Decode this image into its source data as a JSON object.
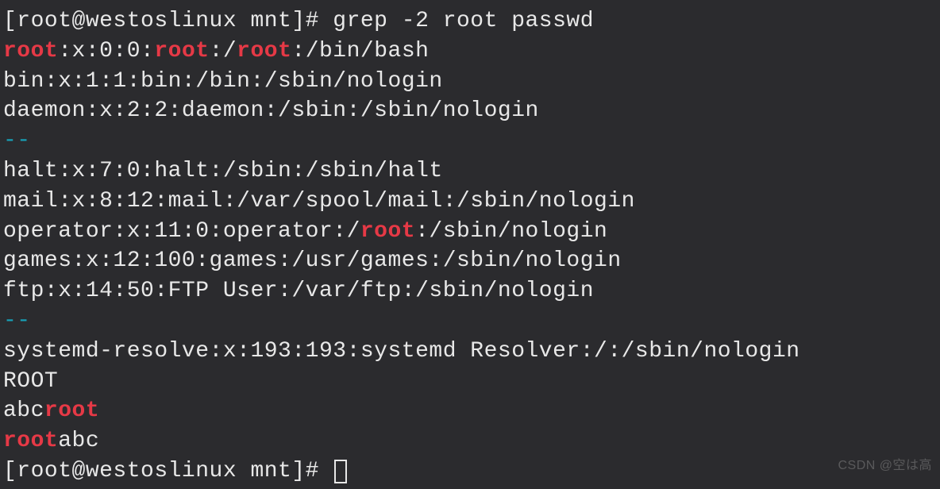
{
  "prompt1_prefix": "[root@westoslinux mnt]# ",
  "command": "grep -2 root passwd",
  "lines": [
    {
      "type": "mixed",
      "parts": [
        {
          "t": "root",
          "h": true
        },
        {
          "t": ":x:0:0:"
        },
        {
          "t": "root",
          "h": true
        },
        {
          "t": ":/"
        },
        {
          "t": "root",
          "h": true
        },
        {
          "t": ":/bin/bash"
        }
      ]
    },
    {
      "type": "plain",
      "text": "bin:x:1:1:bin:/bin:/sbin/nologin"
    },
    {
      "type": "plain",
      "text": "daemon:x:2:2:daemon:/sbin:/sbin/nologin"
    },
    {
      "type": "sep",
      "text": "--"
    },
    {
      "type": "plain",
      "text": "halt:x:7:0:halt:/sbin:/sbin/halt"
    },
    {
      "type": "plain",
      "text": "mail:x:8:12:mail:/var/spool/mail:/sbin/nologin"
    },
    {
      "type": "mixed",
      "parts": [
        {
          "t": "operator:x:11:0:operator:/"
        },
        {
          "t": "root",
          "h": true
        },
        {
          "t": ":/sbin/nologin"
        }
      ]
    },
    {
      "type": "plain",
      "text": "games:x:12:100:games:/usr/games:/sbin/nologin"
    },
    {
      "type": "plain",
      "text": "ftp:x:14:50:FTP User:/var/ftp:/sbin/nologin"
    },
    {
      "type": "sep",
      "text": "--"
    },
    {
      "type": "plain",
      "text": "systemd-resolve:x:193:193:systemd Resolver:/:/sbin/nologin"
    },
    {
      "type": "plain",
      "text": "ROOT"
    },
    {
      "type": "mixed",
      "parts": [
        {
          "t": "abc"
        },
        {
          "t": "root",
          "h": true
        }
      ]
    },
    {
      "type": "mixed",
      "parts": [
        {
          "t": "root",
          "h": true
        },
        {
          "t": "abc"
        }
      ]
    }
  ],
  "prompt2_prefix": "[root@westoslinux mnt]# ",
  "watermark": "CSDN @空は高"
}
